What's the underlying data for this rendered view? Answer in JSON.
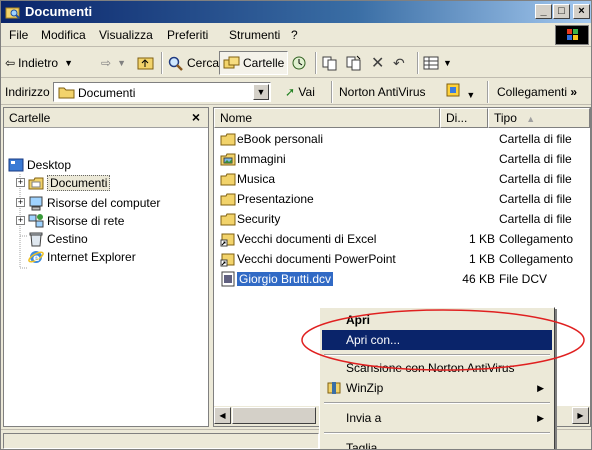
{
  "window": {
    "title": "Documenti"
  },
  "menu": [
    "File",
    "Modifica",
    "Visualizza",
    "Preferiti",
    "Strumenti",
    "?"
  ],
  "toolbar": {
    "back": "Indietro",
    "search": "Cerca",
    "folders": "Cartelle"
  },
  "address": {
    "label": "Indirizzo",
    "value": "Documenti",
    "go": "Vai",
    "norton": "Norton AntiVirus",
    "links": "Collegamenti"
  },
  "tree": {
    "header": "Cartelle",
    "close": "×",
    "items": [
      "Desktop",
      "Documenti",
      "Risorse del computer",
      "Risorse di rete",
      "Cestino",
      "Internet Explorer"
    ]
  },
  "list": {
    "columns": {
      "name": "Nome",
      "size": "Di...",
      "type": "Tipo"
    },
    "rows": [
      {
        "name": "eBook personali",
        "size": "",
        "type": "Cartella di file",
        "icon": "folder-icon"
      },
      {
        "name": "Immagini",
        "size": "",
        "type": "Cartella di file",
        "icon": "pictures-folder-icon"
      },
      {
        "name": "Musica",
        "size": "",
        "type": "Cartella di file",
        "icon": "folder-icon"
      },
      {
        "name": "Presentazione",
        "size": "",
        "type": "Cartella di file",
        "icon": "folder-icon"
      },
      {
        "name": "Security",
        "size": "",
        "type": "Cartella di file",
        "icon": "folder-icon"
      },
      {
        "name": "Vecchi documenti di Excel",
        "size": "1 KB",
        "type": "Collegamento",
        "icon": "shortcut-icon"
      },
      {
        "name": "Vecchi documenti PowerPoint",
        "size": "1 KB",
        "type": "Collegamento",
        "icon": "shortcut-icon"
      },
      {
        "name": "Giorgio Brutti.dcv",
        "size": "46 KB",
        "type": "File DCV",
        "icon": "dcv-file-icon"
      }
    ]
  },
  "context_menu": {
    "open": "Apri",
    "open_with": "Apri con...",
    "scan": "Scansione con Norton AntiVirus",
    "winzip": "WinZip",
    "send_to": "Invia a",
    "cut": "Taglia"
  },
  "colors": {
    "selection": "#316ac5",
    "highlight": "#0a246a",
    "annotation": "#e02020"
  }
}
